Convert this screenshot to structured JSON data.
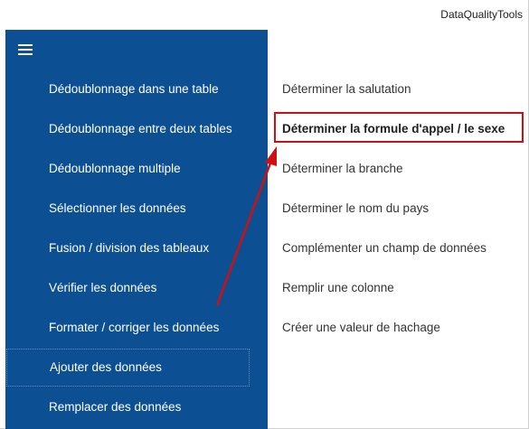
{
  "window": {
    "title": "DataQualityTools"
  },
  "sidebar": {
    "menu_icon": "hamburger-menu-icon",
    "items": [
      {
        "label": "Dédoublonnage dans une table"
      },
      {
        "label": "Dédoublonnage entre deux tables"
      },
      {
        "label": "Dédoublonnage multiple"
      },
      {
        "label": "Sélectionner les données"
      },
      {
        "label": "Fusion / division des tableaux"
      },
      {
        "label": "Vérifier les données"
      },
      {
        "label": "Formater / corriger les données"
      },
      {
        "label": "Ajouter des données",
        "selected": true
      },
      {
        "label": "Remplacer des données"
      }
    ]
  },
  "content": {
    "items": [
      {
        "label": "Déterminer la salutation"
      },
      {
        "label": "Déterminer la formule d'appel / le sexe",
        "highlighted": true
      },
      {
        "label": "Déterminer la branche"
      },
      {
        "label": "Déterminer le nom du pays"
      },
      {
        "label": "Complémenter un champ de données"
      },
      {
        "label": "Remplir une colonne"
      },
      {
        "label": "Créer une valeur de hachage"
      }
    ]
  },
  "colors": {
    "sidebar_bg": "#0c4f93",
    "annotation": "#d01010"
  }
}
